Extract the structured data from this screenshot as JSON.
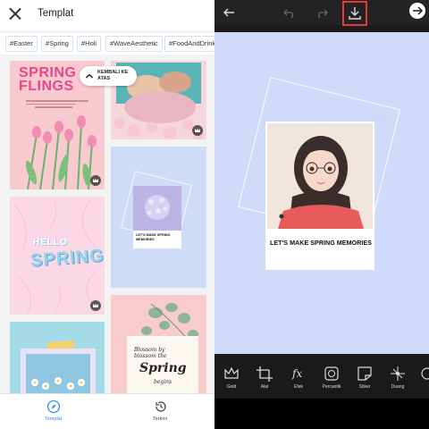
{
  "left_panel": {
    "title": "Templat",
    "chips": [
      "#Easter",
      "#Spring",
      "#Holi",
      "#WaveAesthetic",
      "#FoodAndDrink"
    ],
    "cards": {
      "spring_flings_line1": "SPRING",
      "spring_flings_line2": "FLINGS",
      "hello_text": "HELLO",
      "spring_text": "SPRING",
      "blue_template_caption": "LET'S MAKE SPRING MEMORIES",
      "script_line1": "Blossom by",
      "script_line2": "blossom the",
      "script_big": "Spring",
      "script_line3": "begins"
    },
    "back_to_top_label": "KEMBALI KE ATAS",
    "bottom_tabs": [
      {
        "label": "Templat",
        "icon": "compass-icon",
        "active": true
      },
      {
        "label": "Terkini",
        "icon": "history-icon",
        "active": false
      }
    ],
    "accent_color": "#3a8ef0"
  },
  "right_panel": {
    "caption": "LET'S MAKE SPRING MEMORIES",
    "tools": [
      {
        "label": "Gold",
        "icon": "crown-icon"
      },
      {
        "label": "Alat",
        "icon": "crop-icon"
      },
      {
        "label": "Efek",
        "icon": "fx-icon"
      },
      {
        "label": "Percantik",
        "icon": "beautify-icon"
      },
      {
        "label": "Stiker",
        "icon": "sticker-icon"
      },
      {
        "label": "Duang",
        "icon": "sparkle-icon"
      }
    ],
    "download_highlight_color": "#e53935",
    "canvas_color": "#cfdbf9"
  }
}
